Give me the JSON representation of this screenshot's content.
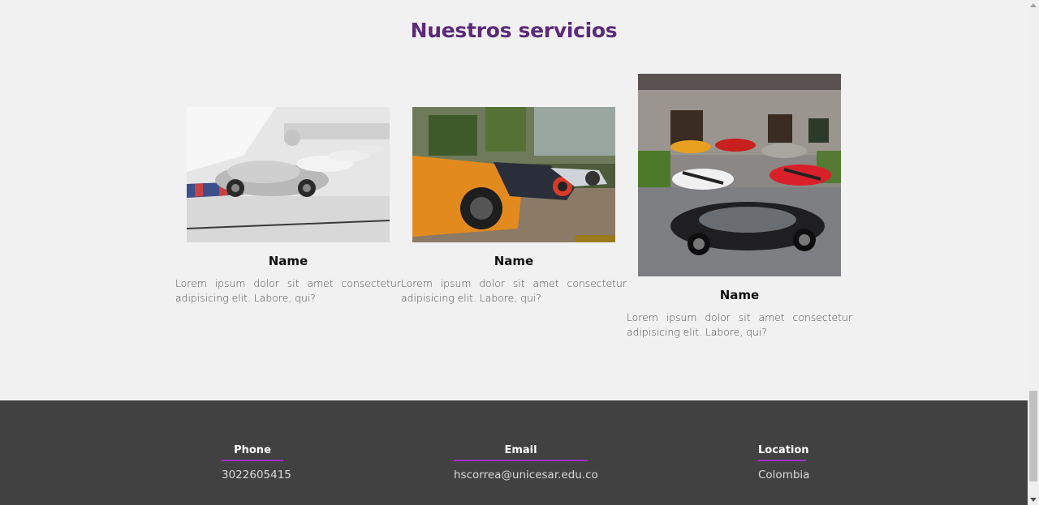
{
  "section": {
    "title": "Nuestros servicios"
  },
  "cards": [
    {
      "name": "Name",
      "description": "Lorem ipsum dolor sit amet consectetur adipisicing elit. Labore, qui?",
      "image": "porsche-museum-photo"
    },
    {
      "name": "Name",
      "description": "Lorem ipsum dolor sit amet consectetur adipisicing elit. Labore, qui?",
      "image": "supercars-lineup-photo"
    },
    {
      "name": "Name",
      "description": "Lorem ipsum dolor sit amet consectetur adipisicing elit. Labore, qui?",
      "image": "exotic-cars-mansion-photo"
    }
  ],
  "footer": {
    "phone_label": "Phone",
    "phone_value": "3022605415",
    "email_label": "Email",
    "email_value": "hscorrea@unicesar.edu.co",
    "location_label": "Location",
    "location_value": "Colombia"
  },
  "colors": {
    "background": "#f2f1f2",
    "title": "#5b2a7a",
    "footer_bg": "#414141",
    "footer_accent": "#9b32c2"
  }
}
